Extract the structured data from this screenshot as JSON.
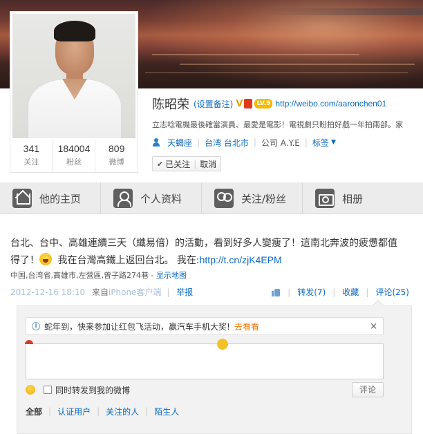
{
  "profile": {
    "name": "陈昭荣",
    "remark_link": "(设置备注)",
    "verified_badge": "V",
    "level_badge": "LV.9",
    "homepage_url": "http://weibo.com/aaronchen01",
    "intro": "立志唸電機最後確當演員、最愛是電影！電視劇只盼拍好戲一年拍兩部。家",
    "constellation": "天蝎座",
    "location": "台湾 台北市",
    "company": "公司 A.Y.E",
    "tags_label": "标签",
    "follow_status": "已关注",
    "unfollow_label": "取消",
    "icons": {
      "gender": "person-icon",
      "check": "checkmark-icon",
      "tags_dropdown": "caret-down-icon"
    }
  },
  "stats": [
    {
      "value": "341",
      "label": "关注"
    },
    {
      "value": "184004",
      "label": "粉丝"
    },
    {
      "value": "809",
      "label": "微博"
    }
  ],
  "tabs": [
    {
      "label": "他的主页",
      "icon": "home-icon"
    },
    {
      "label": "个人资料",
      "icon": "person-icon"
    },
    {
      "label": "关注/粉丝",
      "icon": "followers-icon"
    },
    {
      "label": "相册",
      "icon": "camera-icon"
    }
  ],
  "post": {
    "text_line1": "台北、台中、高雄連續三天（纖易倍）的活動，看到好多人變瘦了！這南北奔波的疲憊都值",
    "text_line2_a": "得了！",
    "text_line2_b": " 我在台灣高鐵上返回台北。 我在:",
    "short_link": "http://t.cn/zjK4EPM",
    "location": "中国,台湾省,高雄市,左營區,曾子路274巷",
    "map_link": "显示地图",
    "timestamp": "2012-12-16 18:10",
    "from_label": "来自",
    "client": "iPhone客户端",
    "report": "举报",
    "repost": "转发(7)",
    "favorite": "收藏",
    "comment": "评论(25)"
  },
  "comment_panel": {
    "notice_text": "蛇年到，快来参加让红包飞活动，赢汽车手机大奖!",
    "notice_link": "去看看",
    "notice_close": "×",
    "input_value": "",
    "repost_checkbox_label": "同时转发到我的微博",
    "repost_checked": false,
    "submit_label": "评论",
    "filters": [
      "全部",
      "认证用户",
      "关注的人",
      "陌生人"
    ]
  },
  "colors": {
    "link": "#0a6ac0",
    "notice_link": "#ee7a0a",
    "tab_bg": "#ececec",
    "level_badge": "#f5b900"
  }
}
